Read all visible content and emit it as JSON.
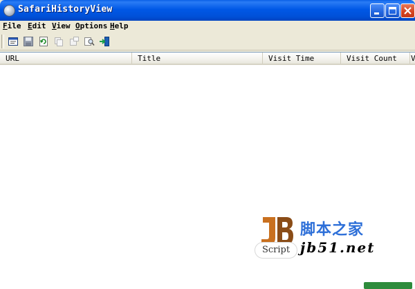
{
  "window": {
    "title": "SafariHistoryView",
    "icon": "app-globe-icon",
    "controls": [
      "minimize-icon",
      "maximize-icon",
      "close-icon"
    ]
  },
  "menu": {
    "items": [
      {
        "first": "F",
        "rest": "ile"
      },
      {
        "first": "E",
        "rest": "dit"
      },
      {
        "first": "V",
        "rest": "iew"
      },
      {
        "first": "O",
        "rest": "ptions"
      },
      {
        "first": "H",
        "rest": "elp"
      }
    ]
  },
  "toolbar": {
    "buttons": [
      "properties-icon",
      "save-icon",
      "refresh-icon",
      "copy-icon",
      "copy-url-icon",
      "find-icon",
      "exit-icon"
    ]
  },
  "list": {
    "columns": [
      "URL",
      "Title",
      "Visit Time",
      "Visit Count",
      "V"
    ],
    "rows": []
  },
  "watermark": {
    "logo_script": "Script",
    "site_name_cn": "脚本之家",
    "site_url": "jb51.net"
  },
  "colors": {
    "titlebar": "#0058e6",
    "chrome": "#ece9d8",
    "watermark_blue": "#2d6fd8",
    "watermark_orange": "#c9701f"
  }
}
